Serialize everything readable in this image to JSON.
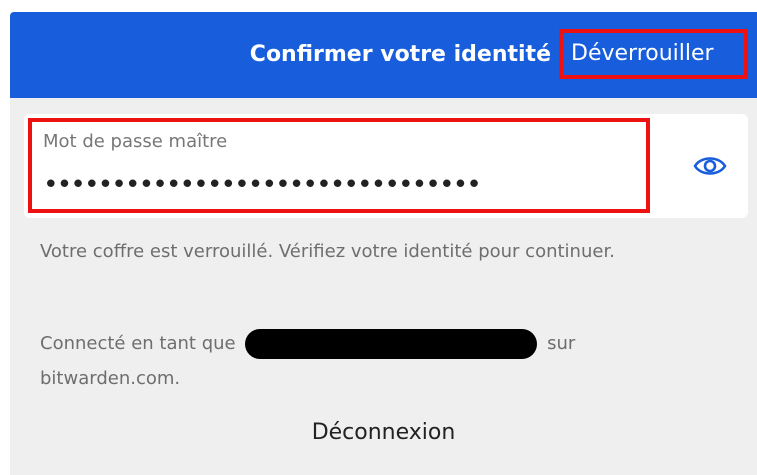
{
  "header": {
    "title": "Confirmer votre identité",
    "unlock_label": "Déverrouiller"
  },
  "password_field": {
    "label": "Mot de passe maître",
    "value": "********************************",
    "toggle_icon": "eye-icon"
  },
  "messages": {
    "locked": "Votre coffre est verrouillé. Vérifiez votre identité pour continuer.",
    "logged_in_prefix": "Connecté en tant que",
    "logged_in_suffix": "sur bitwarden.com."
  },
  "logout_label": "Déconnexion",
  "colors": {
    "header_bg": "#175ddc",
    "highlight_border": "#ee1111",
    "panel_bg": "#efefef"
  }
}
